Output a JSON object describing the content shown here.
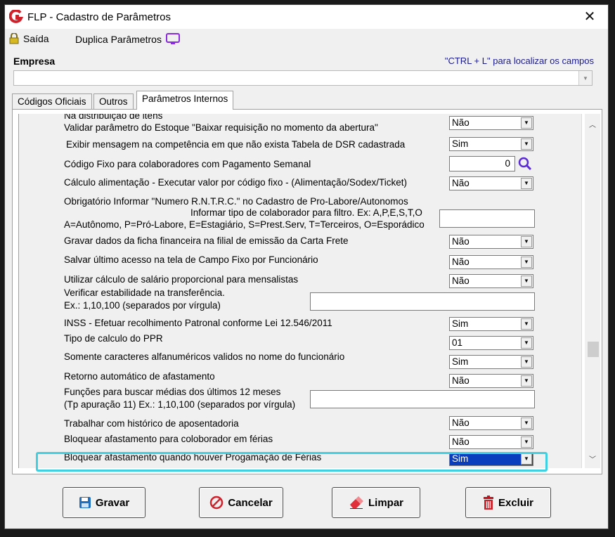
{
  "window": {
    "title": "FLP - Cadastro de Parâmetros",
    "logo_letter": "G",
    "close_glyph": "✕"
  },
  "toolbar": {
    "exit_label": "Saída",
    "duplicate_label": "Duplica Parâmetros"
  },
  "empresa": {
    "label": "Empresa",
    "hint": "\"CTRL + L\" para localizar os campos",
    "value": ""
  },
  "tabs": [
    {
      "label": "Códigos Oficiais"
    },
    {
      "label": "Outros"
    },
    {
      "label": "Parâmetros Internos"
    }
  ],
  "params": {
    "p0_label_cut": "Na distribuição de itens",
    "p0_label": "Validar parâmetro do Estoque \"Baixar requisição no momento da abertura\"",
    "p0_value": "Não",
    "p1_label": "Exibir mensagem na competência em que não exista Tabela de DSR cadastrada",
    "p1_value": "Sim",
    "p2_label": "Código Fixo para colaboradores com Pagamento Semanal",
    "p2_value": "0",
    "p3_label": "Cálculo alimentação - Executar valor por código fixo - (Alimentação/Sodex/Ticket)",
    "p3_value": "Não",
    "p4_label": "Obrigatório Informar \"Numero R.N.T.R.C.\" no Cadastro de Pro-Labore/Autonomos",
    "p5_label_1": "Informar tipo de colaborador para filtro. Ex: A,P,E,S,T,O",
    "p5_label_2": "A=Autônomo, P=Pró-Labore, E=Estagiário, S=Prest.Serv, T=Terceiros, O=Esporádico",
    "p5_value": "",
    "p6_label": "Gravar dados da ficha financeira na filial de emissão da Carta Frete",
    "p6_value": "Não",
    "p7_label": "Salvar último acesso na tela de Campo Fixo por Funcionário",
    "p7_value": "Não",
    "p8_label": "Utilizar cálculo de salário proporcional para mensalistas",
    "p8_value": "Não",
    "p9_label_1": "Verificar estabilidade na transferência.",
    "p9_label_2": "Ex.: 1,10,100 (separados por vírgula)",
    "p9_value": "",
    "p10_label": "INSS - Efetuar recolhimento Patronal conforme Lei 12.546/2011",
    "p10_value": "Sim",
    "p11_label": "Tipo de calculo do PPR",
    "p11_value": "01",
    "p12_label": "Somente caracteres alfanuméricos validos no nome do funcionário",
    "p12_value": "Sim",
    "p13_label": "Retorno automático de afastamento",
    "p13_value": "Não",
    "p14_label_1": "Funções para buscar médias dos últimos 12 meses",
    "p14_label_2": "(Tp apuração 11)  Ex.: 1,10,100 (separados por vírgula)",
    "p14_value": "",
    "p15_label": "Trabalhar com histórico de aposentadoria",
    "p15_value": "Não",
    "p16_label": "Bloquear afastamento para coloborador em férias",
    "p16_value": "Não",
    "p17_label": "Bloquear afastamento quando houver Progamação de Férias",
    "p17_value": "Sim"
  },
  "buttons": {
    "save": "Gravar",
    "cancel": "Cancelar",
    "clear": "Limpar",
    "delete": "Excluir"
  },
  "colors": {
    "highlight_border": "#3fd0e2",
    "selected_bg": "#0a3dbd",
    "logo_red": "#d0202a",
    "monitor_purple": "#8a2be2"
  }
}
